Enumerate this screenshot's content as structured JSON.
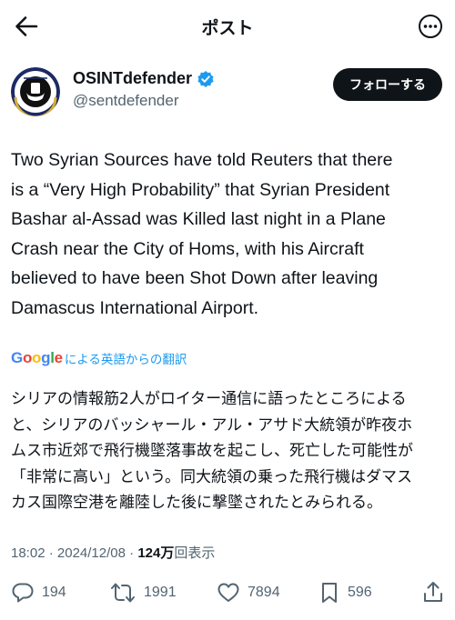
{
  "header": {
    "title": "ポスト"
  },
  "author": {
    "display_name": "OSINTdefender",
    "handle": "@sentdefender",
    "follow_label": "フォローする"
  },
  "tweet": {
    "text_lines": [
      "Two Syrian Sources have told Reuters that there",
      "is a “Very High Probability” that Syrian President",
      "Bashar al-Assad was Killed last night in a Plane",
      "Crash near the City of Homs, with his Aircraft",
      "believed to have been Shot Down after leaving",
      "Damascus International Airport."
    ],
    "translate": {
      "google_letters": [
        "G",
        "o",
        "o",
        "g",
        "l",
        "e"
      ],
      "label": "による英語からの翻訳"
    },
    "translated_lines": [
      "シリアの情報筋2人がロイター通信に語ったところによる",
      "と、シリアのバッシャール・アル・アサド大統領が昨夜ホ",
      "ムス市近郊で飛行機墜落事故を起こし、死亡した可能性が",
      "「非常に高い」という。同大統領の乗った飛行機はダマス",
      "カス国際空港を離陸した後に撃墜されたとみられる。"
    ],
    "meta": {
      "time": "18:02",
      "date": "2024/12/08",
      "views": "124万",
      "views_label": "回表示"
    }
  },
  "actions": {
    "replies": "194",
    "reposts": "1991",
    "likes": "7894",
    "bookmarks": "596"
  },
  "colors": {
    "accent": "#1d9bf0",
    "text": "#0f1419",
    "secondary": "#536471",
    "google": [
      "#4285F4",
      "#EA4335",
      "#FBBC05",
      "#4285F4",
      "#34A853",
      "#EA4335"
    ]
  }
}
